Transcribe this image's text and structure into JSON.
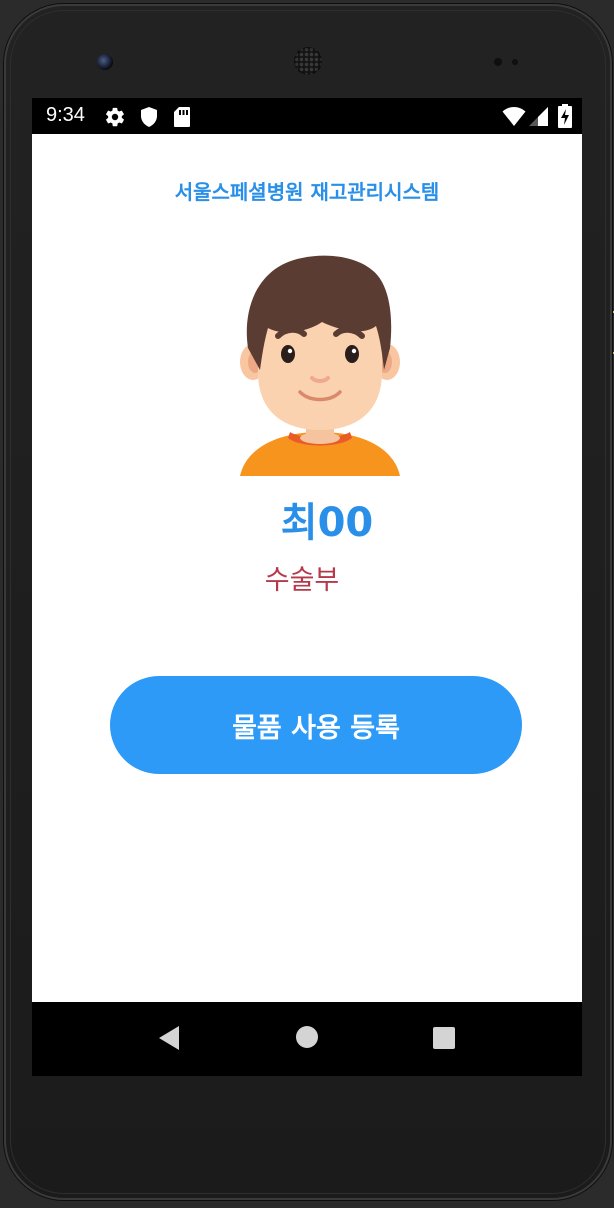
{
  "status_bar": {
    "time": "9:34",
    "icons": [
      "gear-icon",
      "shield-icon",
      "sd-card-icon",
      "wifi-icon",
      "signal-icon",
      "battery-charging-icon"
    ]
  },
  "app": {
    "title": "서울스페셜병원 재고관리시스템"
  },
  "user": {
    "name": "최00",
    "department": "수술부",
    "avatar_icon": "boy-avatar-icon"
  },
  "actions": {
    "register_label": "물품 사용 등록"
  },
  "navigation": {
    "buttons": [
      "back-icon",
      "home-icon",
      "recents-icon"
    ]
  },
  "colors": {
    "accent": "#2a8fe8",
    "button": "#2c9af6",
    "department_text": "#b5394a"
  }
}
